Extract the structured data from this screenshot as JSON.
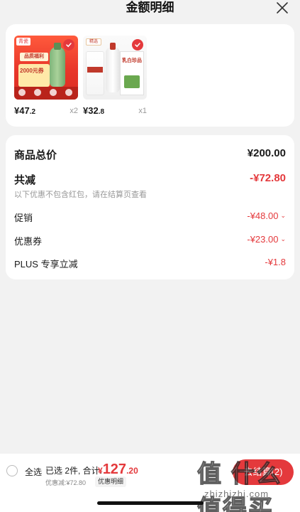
{
  "header": {
    "title": "金额明细"
  },
  "products": [
    {
      "price_int": "¥47",
      "price_dec": ".2",
      "qty": "x2",
      "img_text_brand": "青瓷",
      "img_text_banner": "品质福利",
      "img_text_amount": "2000元券"
    },
    {
      "price_int": "¥32",
      "price_dec": ".8",
      "qty": "x1",
      "img_text_brand": "精选",
      "img_text_box": "乳白珍品"
    }
  ],
  "summary": {
    "total_label": "商品总价",
    "total_value": "¥200.00",
    "reduce_label": "共减",
    "reduce_value": "-¥72.80",
    "note": "以下优惠不包含红包，请在结算页查看",
    "promo_label": "促销",
    "promo_value": "-¥48.00",
    "coupon_label": "优惠券",
    "coupon_value": "-¥23.00",
    "plus_label": "PLUS 专享立减",
    "plus_value": "-¥1.8"
  },
  "bottom": {
    "select_all": "全选",
    "selected_text": "已选 2件, 合计:",
    "total_symbol": "¥",
    "total_int": "127",
    "total_dec": ".20",
    "discount_text": "优惠减:¥72.80",
    "detail_label": "优惠明细",
    "checkout_label": "去结算(2)"
  },
  "watermark": {
    "text": "值 什么值得买",
    "domain": "zhizhizhi.com"
  },
  "colors": {
    "accent": "#e4393c",
    "price_red": "#e4393c",
    "bg": "#f2f2f2"
  }
}
